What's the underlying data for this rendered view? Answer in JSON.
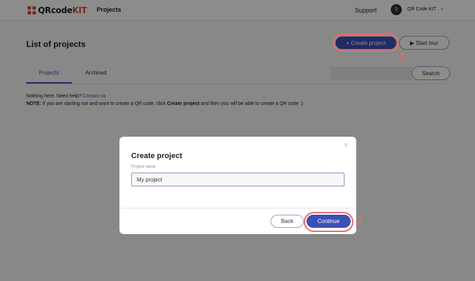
{
  "header": {
    "logo_text": "QRcode",
    "logo_text_accent": "KIT",
    "nav_projects": "Projects",
    "support": "Support",
    "avatar_initial": "Q",
    "account_name": "QR Code KIT"
  },
  "page": {
    "title": "List of projects",
    "create_button": "+ Create project",
    "tour_button": "▶ Start tour",
    "tabs": [
      {
        "label": "Projects"
      },
      {
        "label": "Archived"
      }
    ],
    "search_button": "Search",
    "help_line1_prefix": "Nothing here. Need help?",
    "help_line1_link": "Contact us",
    "help_note_label": "NOTE:",
    "help_note_text1": "If you are starting out and want to create a QR code, click",
    "help_note_bold": "Create project",
    "help_note_text2": "and then you will be able to create a QR code :)"
  },
  "modal": {
    "close": "×",
    "title": "Create project",
    "field_label": "Project name",
    "field_value": "My project",
    "back_button": "Back",
    "continue_button": "Continue"
  },
  "annotations": {
    "step1": "1",
    "step2": "2",
    "highlight_color": "#e76b6b"
  },
  "colors": {
    "accent": "#3e4fb5",
    "brand_red": "#e04a3a"
  }
}
